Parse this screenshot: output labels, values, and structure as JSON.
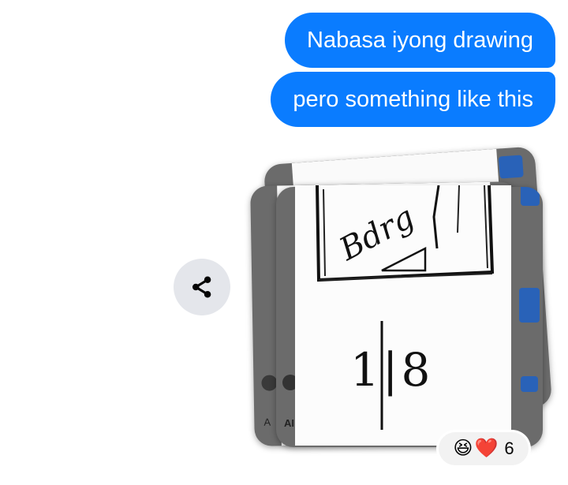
{
  "messages": [
    {
      "text": "Nabasa iyong drawing"
    },
    {
      "text": "pero something like this"
    }
  ],
  "photo": {
    "handwriting_word": "Bdrg",
    "fraction_label": "1|8",
    "side_letter": "A",
    "side_letters": "AI"
  },
  "share": {
    "icon": "share-icon"
  },
  "reactions": {
    "emojis": [
      "😆",
      "❤️"
    ],
    "count": "6"
  },
  "colors": {
    "bubble": "#0a7cff",
    "share_bg": "#e4e6eb",
    "pill_bg": "#f2f2f2"
  }
}
